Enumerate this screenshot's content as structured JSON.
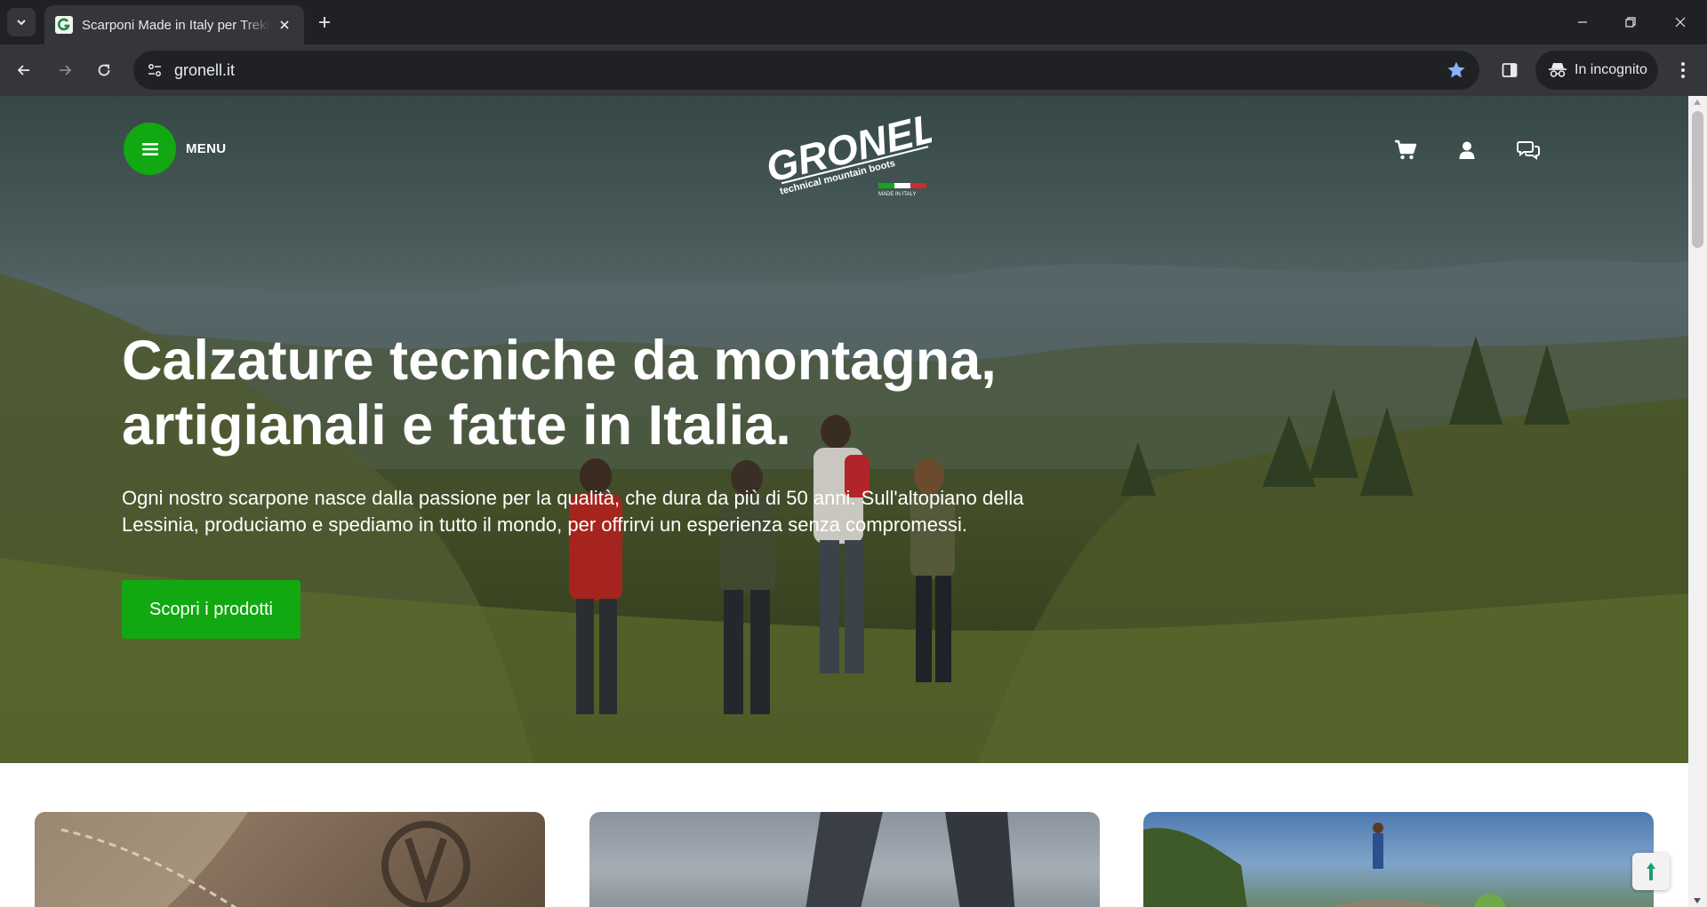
{
  "browser": {
    "tab_title": "Scarponi Made in Italy per Trekking",
    "url": "gronell.it",
    "incognito_label": "In incognito"
  },
  "header": {
    "menu_label": "MENU",
    "logo_text": "GRONELL",
    "logo_tagline": "technical mountain boots",
    "logo_badge": "MADE IN ITALY"
  },
  "hero": {
    "title_line1": "Calzature tecniche da montagna,",
    "title_line2": "artigianali e fatte in Italia.",
    "text_line1": "Ogni nostro scarpone nasce dalla passione per la qualità, che dura da più di 50 anni. Sull'altopiano della",
    "text_line2": "Lessinia, produciamo e spediamo in tutto il mondo, per offrirvi un esperienza senza compromessi.",
    "cta_label": "Scopri i prodotti"
  },
  "colors": {
    "brand_green": "#12a812",
    "chrome_dark": "#202124",
    "chrome_toolbar": "#35363a",
    "bookmark_star": "#8ab4f8"
  },
  "icons": {
    "header": [
      "cart-icon",
      "user-icon",
      "chat-icon"
    ],
    "toolbar": [
      "back-icon",
      "forward-icon",
      "reload-icon",
      "site-info-icon",
      "star-icon",
      "side-panel-icon",
      "incognito-icon",
      "kebab-menu-icon"
    ]
  }
}
